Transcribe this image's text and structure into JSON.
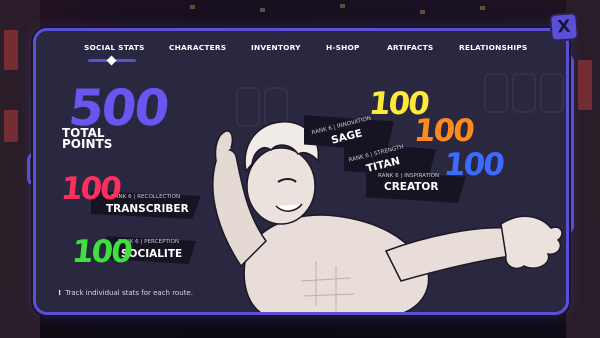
{
  "nav": {
    "tabs": [
      {
        "label": "SOCIAL STATS",
        "active": true
      },
      {
        "label": "CHARACTERS"
      },
      {
        "label": "INVENTORY"
      },
      {
        "label": "H-SHOP"
      },
      {
        "label": "ARTIFACTS"
      },
      {
        "label": "RELATIONSHIPS"
      }
    ],
    "close_label": "X"
  },
  "total": {
    "value": "500",
    "label_line1": "TOTAL",
    "label_line2": "POINTS"
  },
  "stats": [
    {
      "rank": "RANK 6 | INNOVATION",
      "name": "SAGE",
      "value": "100",
      "color": "#ffe83a"
    },
    {
      "rank": "RANK 6 | STRENGTH",
      "name": "TITAN",
      "value": "100",
      "color": "#ff8a1e"
    },
    {
      "rank": "RANK 6 | INSPIRATION",
      "name": "CREATOR",
      "value": "100",
      "color": "#3b6cff"
    },
    {
      "rank": "RANK 6 | RECOLLECTION",
      "name": "TRANSCRIBER",
      "value": "100",
      "color": "#ff2e5d"
    },
    {
      "rank": "RANK 6 | PERCEPTION",
      "name": "SOCIALITE",
      "value": "100",
      "color": "#3fe03f"
    }
  ],
  "footer": {
    "hint": "Track individual stats for each route."
  },
  "colors": {
    "accent": "#5b4fd6",
    "panel": "#2a2740",
    "total": "#6a55f0"
  }
}
